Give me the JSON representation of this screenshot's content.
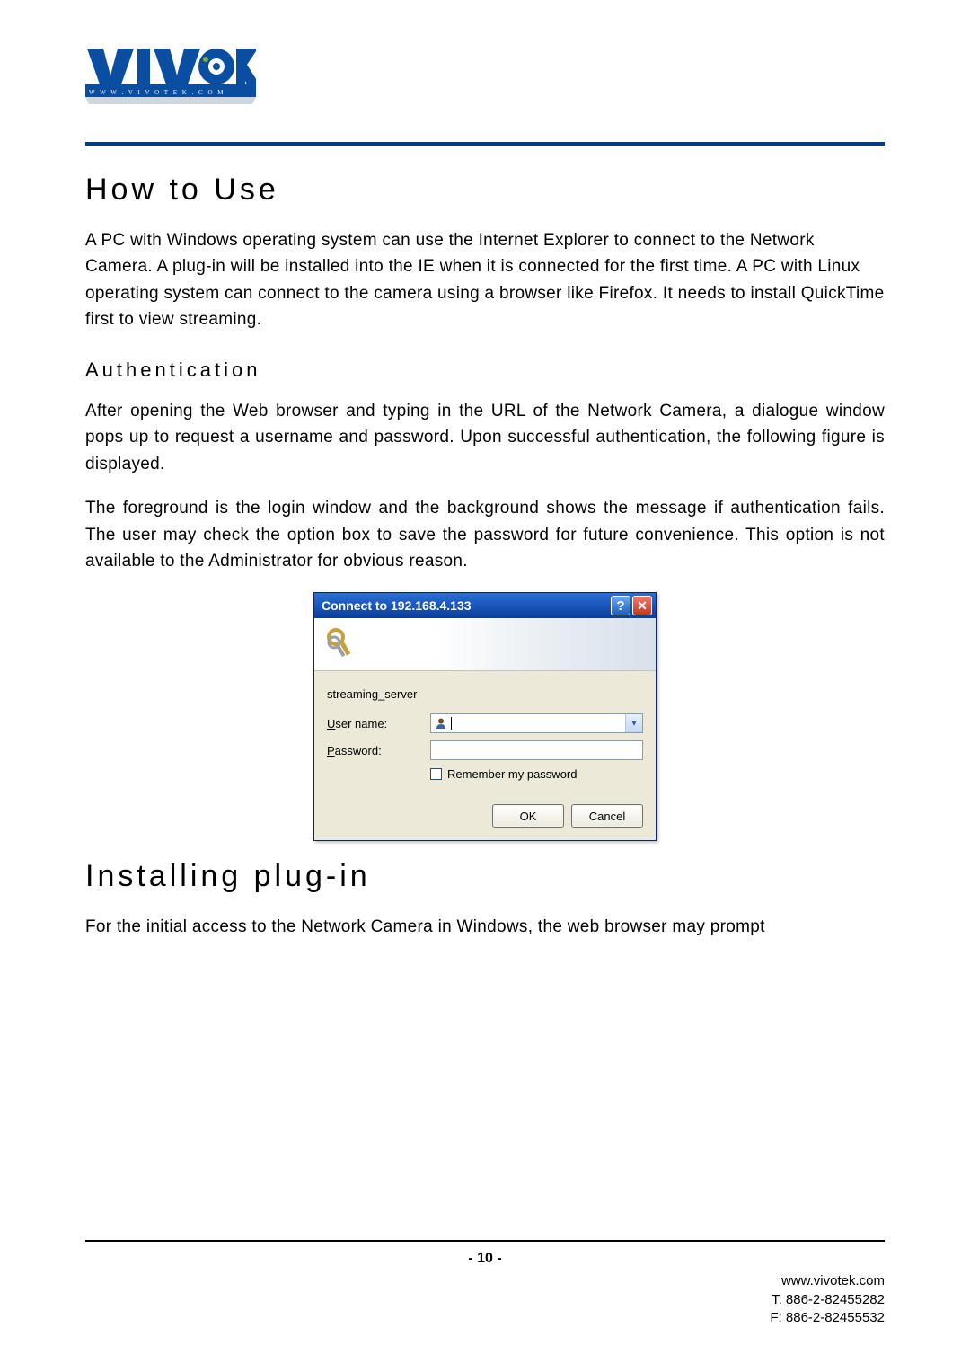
{
  "logo": {
    "brand": "VIVOTEK",
    "subtext": "www.vivotek.com"
  },
  "heading1": "How to Use",
  "para1": "A PC with Windows operating system can use the Internet Explorer to connect to the Network Camera. A plug-in will be installed into the IE when it is connected for the first time. A PC with Linux operating system can connect to the camera using a browser like Firefox. It needs to install QuickTime first to view streaming.",
  "sub1": "Authentication",
  "para2": "After opening the Web browser and typing in the URL of the Network Camera, a dialogue window pops up to request a username and password. Upon successful authentication, the following figure is displayed.",
  "para3": "The foreground is the login window and the background shows the message if authentication fails. The user may check the option box to save the password for future convenience.   This option is not available to the Administrator for obvious reason.",
  "dialog": {
    "title": "Connect to 192.168.4.133",
    "realm": "streaming_server",
    "username_label_pre": "U",
    "username_label_post": "ser name:",
    "password_label_pre": "P",
    "password_label_post": "assword:",
    "remember_pre": "R",
    "remember_post": "emember my password",
    "ok": "OK",
    "cancel": "Cancel"
  },
  "heading2": "Installing plug-in",
  "para4": "For the initial access to the Network Camera in Windows, the web browser may prompt",
  "footer": {
    "page": "- 10 -",
    "url": "www.vivotek.com",
    "tel": "T: 886-2-82455282",
    "fax": "F: 886-2-82455532"
  }
}
